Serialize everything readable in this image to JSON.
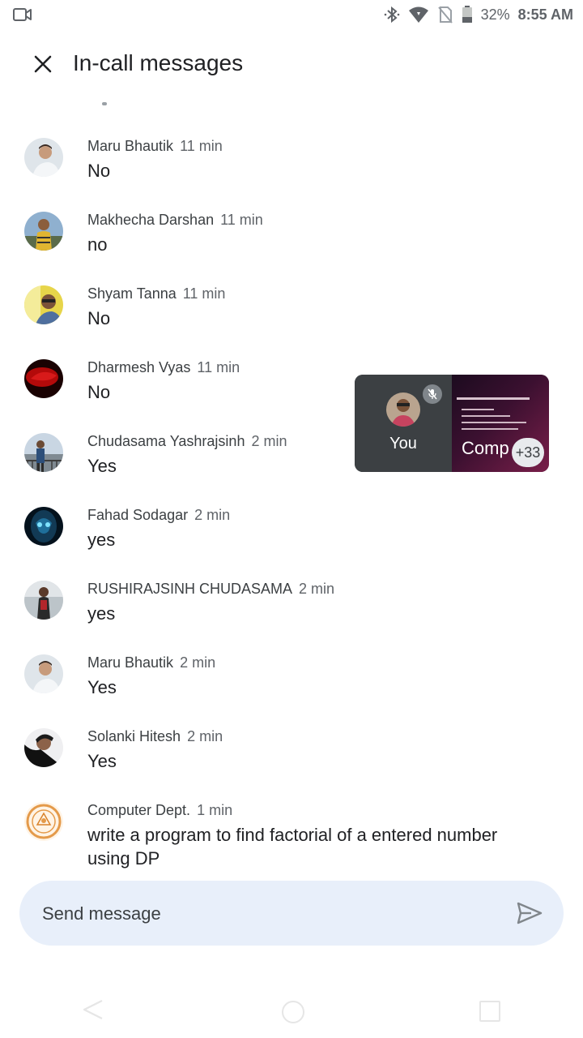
{
  "status_bar": {
    "battery_percent": "32%",
    "time": "8:55 AM",
    "icons": [
      "video-icon",
      "bluetooth-icon",
      "wifi-icon",
      "no-sim-icon",
      "battery-icon"
    ]
  },
  "header": {
    "title": "In-call messages",
    "close_icon": "close-icon"
  },
  "messages": [
    {
      "name": "Maru Bhautik",
      "time": "11 min",
      "text": "No"
    },
    {
      "name": "Makhecha Darshan",
      "time": "11 min",
      "text": "no"
    },
    {
      "name": "Shyam Tanna",
      "time": "11 min",
      "text": "No"
    },
    {
      "name": "Dharmesh Vyas",
      "time": "11 min",
      "text": "No"
    },
    {
      "name": "Chudasama Yashrajsinh",
      "time": "2 min",
      "text": "Yes"
    },
    {
      "name": "Fahad Sodagar",
      "time": "2 min",
      "text": "yes"
    },
    {
      "name": "RUSHIRAJSINH CHUDASAMA",
      "time": "2 min",
      "text": "yes"
    },
    {
      "name": "Maru Bhautik",
      "time": "2 min",
      "text": "Yes"
    },
    {
      "name": "Solanki Hitesh",
      "time": "2 min",
      "text": "Yes"
    },
    {
      "name": "Computer Dept.",
      "time": "1 min",
      "text": "write a program to find factorial of a entered number using DP"
    }
  ],
  "pip": {
    "self_label": "You",
    "share_label": "Comp",
    "participant_count": "+33",
    "mute_icon": "mic-off-icon"
  },
  "composer": {
    "placeholder": "Send message",
    "send_icon": "send-icon"
  },
  "nav_bar": {
    "icons": [
      "back-icon",
      "home-icon",
      "recents-icon"
    ]
  }
}
